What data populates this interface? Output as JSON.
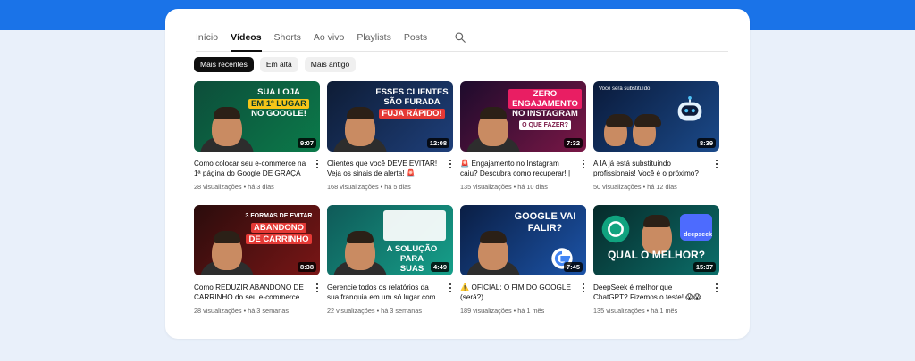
{
  "tabs": [
    {
      "label": "Início",
      "active": false
    },
    {
      "label": "Vídeos",
      "active": true
    },
    {
      "label": "Shorts",
      "active": false
    },
    {
      "label": "Ao vivo",
      "active": false
    },
    {
      "label": "Playlists",
      "active": false
    },
    {
      "label": "Posts",
      "active": false
    }
  ],
  "chips": [
    {
      "label": "Mais recentes",
      "active": true
    },
    {
      "label": "Em alta",
      "active": false
    },
    {
      "label": "Mais antigo",
      "active": false
    }
  ],
  "videos": [
    {
      "thumb_text": [
        "Sua loja",
        "em 1º lugar",
        "no Google!"
      ],
      "accent_color": "#f5c518",
      "duration": "9:07",
      "title": "Como colocar seu e-commerce na 1ª página do Google DE GRAÇA",
      "views": "28 visualizações",
      "age": "há 3 dias"
    },
    {
      "thumb_text": [
        "Esses clientes",
        "são furada",
        "fuja rápido!"
      ],
      "accent_color": "#e53935",
      "duration": "12:08",
      "title": "Clientes que você DEVE EVITAR! Veja os sinais de alerta! 🚨",
      "views": "168 visualizações",
      "age": "há 5 dias"
    },
    {
      "thumb_text": [
        "Zero engajamento",
        "no Instagram",
        "o que fazer?"
      ],
      "accent_color": "#e91e63",
      "duration": "7:32",
      "title": "🚨 Engajamento no Instagram caiu? Descubra como recuperar! | Como...",
      "views": "135 visualizações",
      "age": "há 10 dias"
    },
    {
      "thumb_text": [
        "Você será substituído"
      ],
      "accent_color": "#29b6f6",
      "duration": "8:39",
      "title": "A IA já está substituindo profissionais! Você é o próximo? (...",
      "views": "50 visualizações",
      "age": "há 12 dias"
    },
    {
      "thumb_text": [
        "3 formas de evitar",
        "abandono",
        "de carrinho"
      ],
      "accent_color": "#e53935",
      "duration": "8:38",
      "title": "Como REDUZIR ABANDONO DE CARRINHO do seu e-commerce e...",
      "views": "28 visualizações",
      "age": "há 3 semanas"
    },
    {
      "thumb_text": [
        "A solução para",
        "suas franquias!"
      ],
      "accent_color": "#ffffff",
      "duration": "4:49",
      "title": "Gerencie todos os relatórios da sua franquia em um só lugar com...",
      "views": "22 visualizações",
      "age": "há 3 semanas"
    },
    {
      "thumb_text": [
        "Google vai",
        "falir?"
      ],
      "accent_color": "#ffffff",
      "duration": "7:45",
      "title": "⚠️ OFICIAL: O FIM DO GOOGLE (será?)",
      "views": "189 visualizações",
      "age": "há 1 mês"
    },
    {
      "thumb_text": [
        "deepseek",
        "Qual o melhor?"
      ],
      "accent_color": "#ffffff",
      "duration": "15:37",
      "title": "DeepSeek é melhor que ChatGPT? Fizemos o teste! 😱😱",
      "views": "135 visualizações",
      "age": "há 1 mês"
    }
  ]
}
